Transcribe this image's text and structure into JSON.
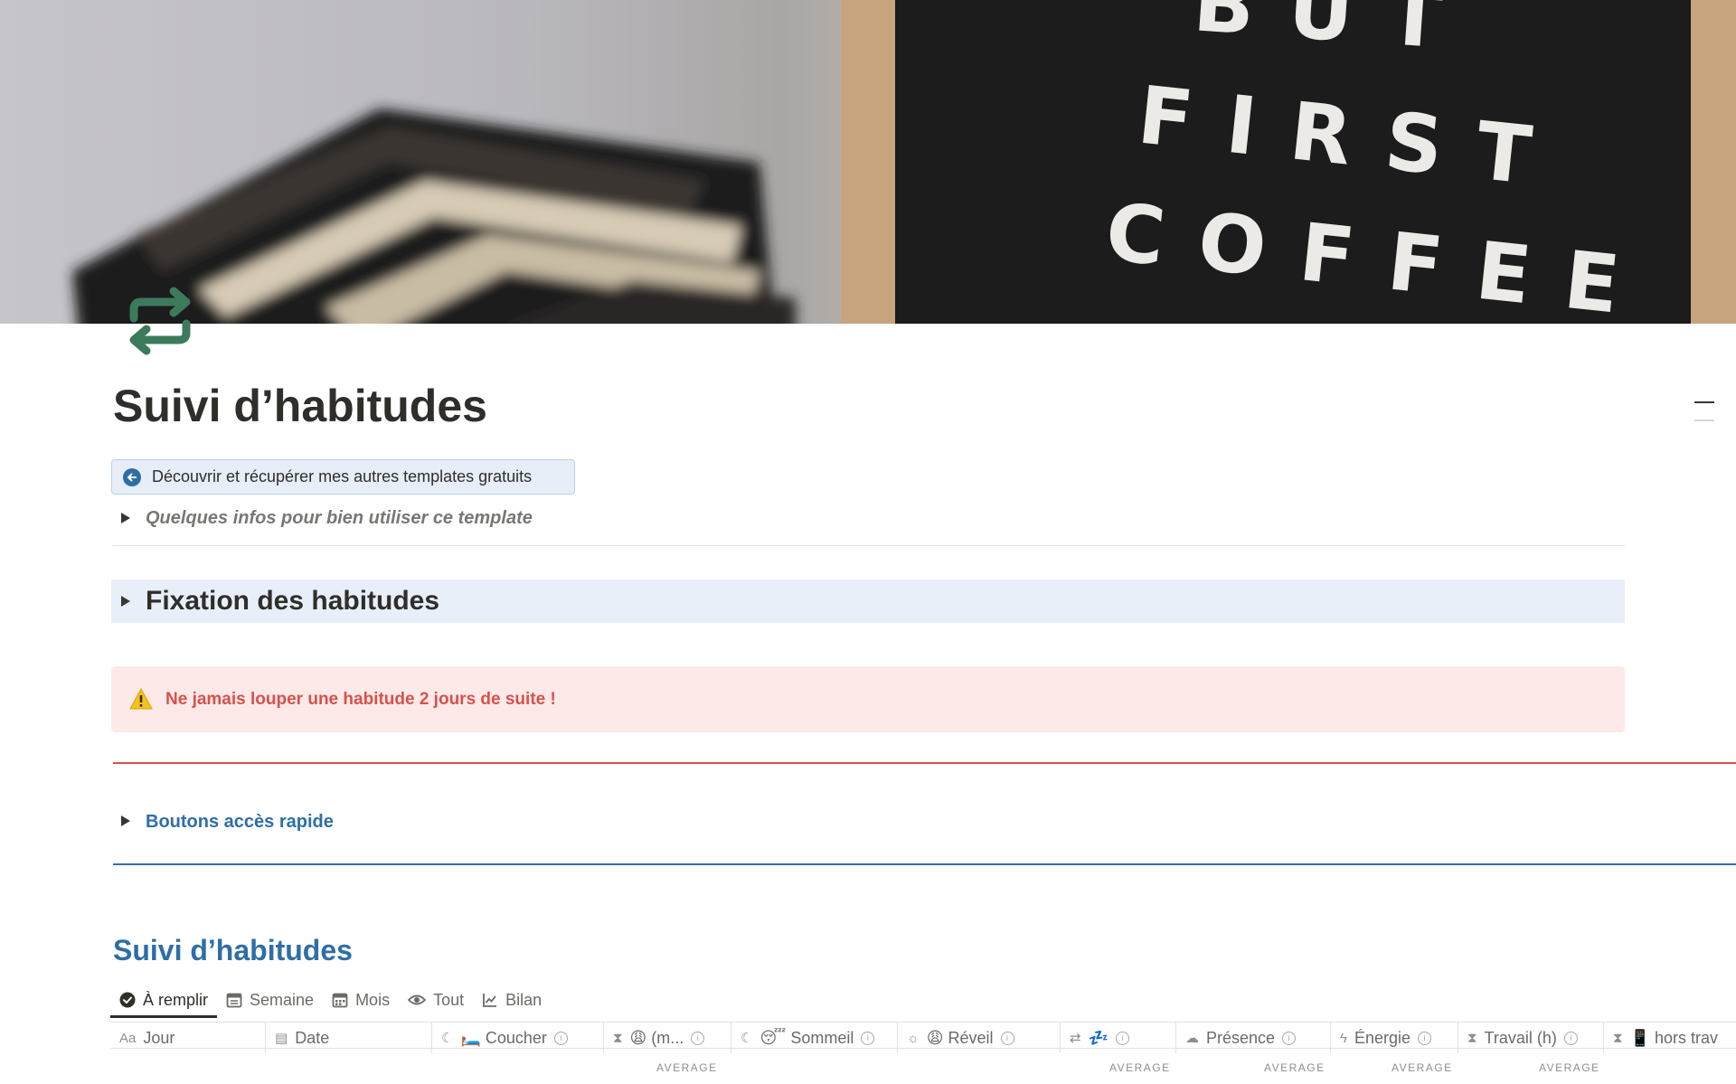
{
  "cover": {
    "board_lines": [
      "BUT",
      "FIRST",
      "COFFEE"
    ]
  },
  "page": {
    "title": "Suivi d’habitudes"
  },
  "template_button": {
    "label": "Découvrir et récupérer mes autres templates gratuits"
  },
  "toggles": {
    "infos": "Quelques infos pour bien utiliser ce template",
    "fixation": "Fixation des habitudes",
    "quick_access": "Boutons accès rapide"
  },
  "callout": {
    "icon": "warning-icon",
    "text": "Ne jamais louper une habitude 2 jours de suite !"
  },
  "database": {
    "title": "Suivi d’habitudes",
    "tabs": [
      {
        "label": "À remplir",
        "icon": "check-circle-icon"
      },
      {
        "label": "Semaine",
        "icon": "calendar-icon"
      },
      {
        "label": "Mois",
        "icon": "calendar-grid-icon"
      },
      {
        "label": "Tout",
        "icon": "eye-icon"
      },
      {
        "label": "Bilan",
        "icon": "chart-line-icon"
      }
    ],
    "columns": [
      {
        "label": "Jour",
        "icon": "Aa"
      },
      {
        "label": "Date",
        "icon": "calendar-icon"
      },
      {
        "label": "🛏️ Coucher",
        "icon": "moon-icon"
      },
      {
        "label": "😩 (m...",
        "icon": "hourglass-icon"
      },
      {
        "label": "😴 Sommeil",
        "icon": "moon-icon"
      },
      {
        "label": "😩 Réveil",
        "icon": "sun-icon"
      },
      {
        "label": "💤",
        "icon": "repeat-icon"
      },
      {
        "label": "Présence",
        "icon": "cloud-icon"
      },
      {
        "label": "Énergie",
        "icon": "bolt-icon"
      },
      {
        "label": "Travail (h)",
        "icon": "hourglass-icon"
      },
      {
        "label": "📱 hors trav",
        "icon": "hourglass-icon"
      }
    ],
    "footer_calc": "AVERAGE"
  },
  "colors": {
    "accent_blue": "#2e6ea6",
    "callout_red": "#d6524b",
    "icon_green": "#3c7a5c"
  }
}
